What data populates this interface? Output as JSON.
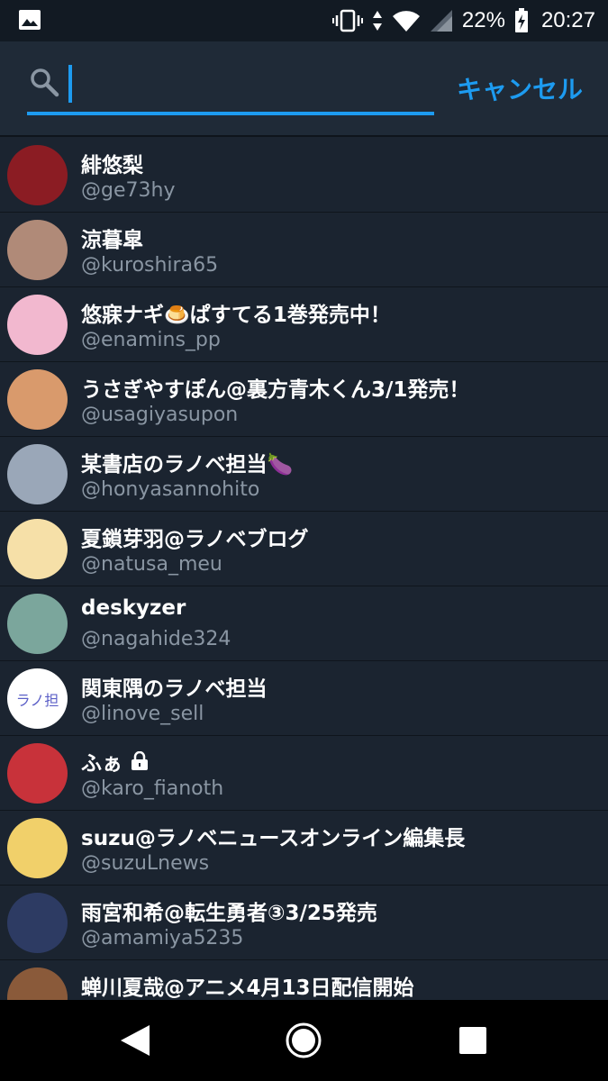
{
  "status_bar": {
    "battery_percent": "22%",
    "time": "20:27",
    "icons": [
      "gallery-icon",
      "vibrate-icon",
      "data-arrows-icon",
      "wifi-icon",
      "signal-icon",
      "battery-charging-icon"
    ]
  },
  "search": {
    "placeholder": "",
    "value": "",
    "cancel_label": "キャンセル"
  },
  "results": [
    {
      "name": "緋悠梨",
      "handle": "@ge73hy",
      "avatar_color": "#8b1c23"
    },
    {
      "name": "涼暮皐",
      "handle": "@kuroshira65",
      "avatar_color": "#b08a78"
    },
    {
      "name": "悠寐ナギ🍮ぱすてる1巻発売中！",
      "handle": "@enamins_pp",
      "avatar_color": "#f2b8cf"
    },
    {
      "name": "うさぎやすぽん@裏方青木くん3/1発売！",
      "handle": "@usagiyasupon",
      "avatar_color": "#d99a6c"
    },
    {
      "name": "某書店のラノベ担当🍆",
      "handle": "@honyasannohito",
      "avatar_color": "#9aa7b8"
    },
    {
      "name": "夏鎖芽羽@ラノベブログ",
      "handle": "@natusa_meu",
      "avatar_color": "#f6e0a8"
    },
    {
      "name": "deskyzer",
      "handle": "@nagahide324",
      "avatar_color": "#7ba69c"
    },
    {
      "name": "関東隅のラノベ担当",
      "handle": "@linove_sell",
      "avatar_color": "#ffffff",
      "avatar_text": "ラノ担"
    },
    {
      "name": "ふぁ",
      "handle": "@karo_fianoth",
      "avatar_color": "#c8323a",
      "protected": true
    },
    {
      "name": "suzu@ラノベニュースオンライン編集長",
      "handle": "@suzuLnews",
      "avatar_color": "#f1d06a"
    },
    {
      "name": "雨宮和希@転生勇者③3/25発売",
      "handle": "@amamiya5235",
      "avatar_color": "#2d3b63"
    },
    {
      "name": "蝉川夏哉@アニメ4月13日配信開始",
      "handle": "",
      "avatar_color": "#8a5a3a"
    }
  ],
  "colors": {
    "background": "#1b2430",
    "header": "#1f2a37",
    "accent": "#1d9bf0",
    "handle_text": "#8a96a3"
  },
  "nav": {
    "icons": [
      "back-icon",
      "home-icon",
      "recent-apps-icon"
    ]
  }
}
